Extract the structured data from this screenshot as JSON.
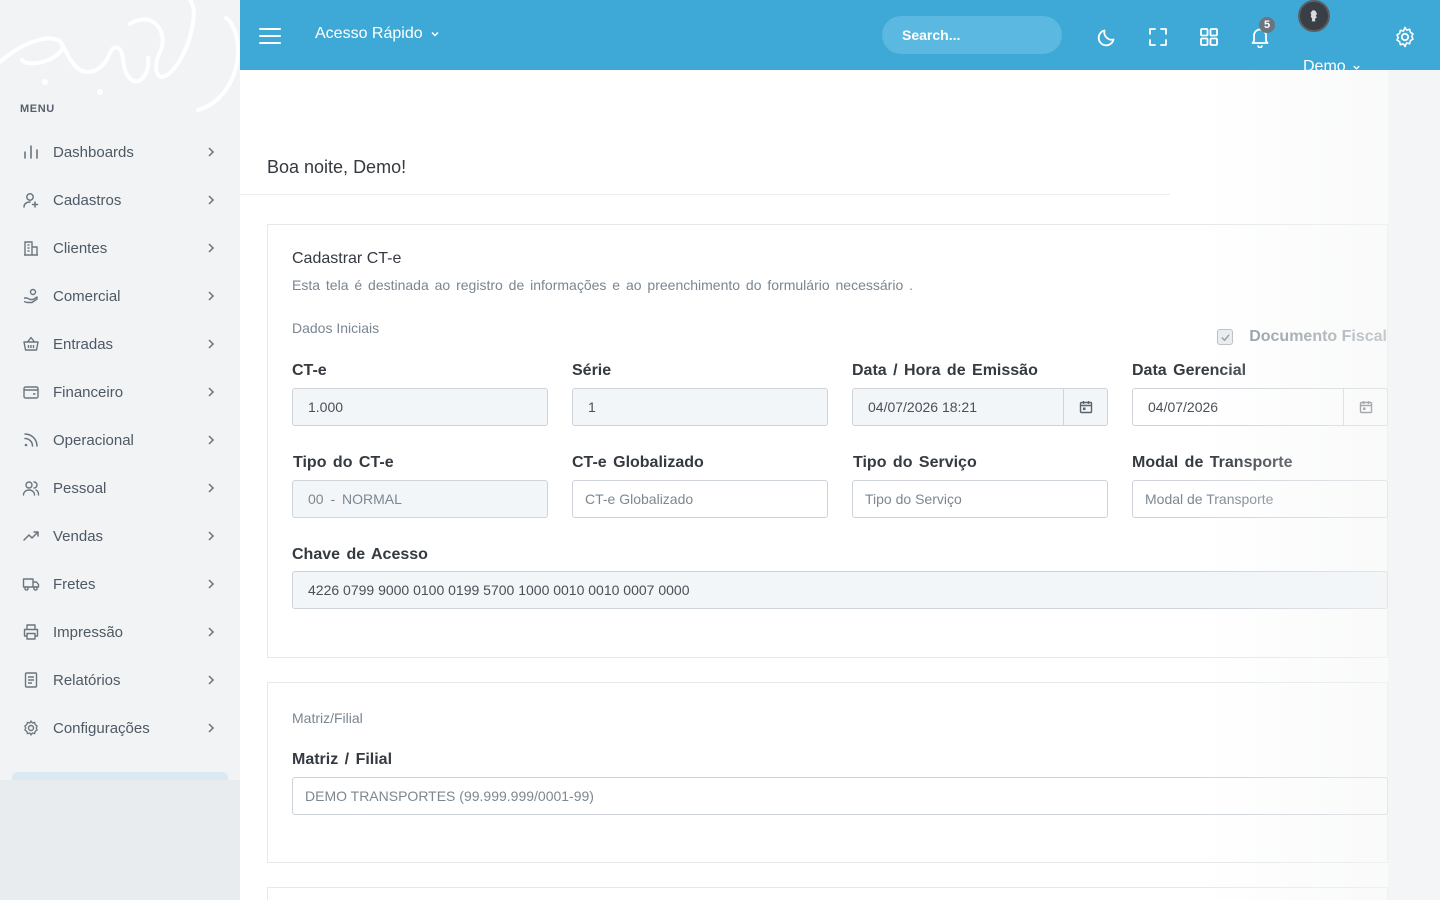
{
  "sidebar": {
    "menu_title": "MENU",
    "items": [
      {
        "label": "Dashboards",
        "icon": "bar-chart-icon"
      },
      {
        "label": "Cadastros",
        "icon": "user-plus-icon"
      },
      {
        "label": "Clientes",
        "icon": "building-icon"
      },
      {
        "label": "Comercial",
        "icon": "hand-coins-icon"
      },
      {
        "label": "Entradas",
        "icon": "basket-icon"
      },
      {
        "label": "Financeiro",
        "icon": "wallet-icon"
      },
      {
        "label": "Operacional",
        "icon": "rss-icon"
      },
      {
        "label": "Pessoal",
        "icon": "users-icon"
      },
      {
        "label": "Vendas",
        "icon": "trending-up-icon"
      },
      {
        "label": "Fretes",
        "icon": "truck-icon"
      },
      {
        "label": "Impressão",
        "icon": "printer-icon"
      },
      {
        "label": "Relatórios",
        "icon": "file-text-icon"
      },
      {
        "label": "Configurações",
        "icon": "settings-icon"
      }
    ]
  },
  "topbar": {
    "quick_access": "Acesso Rápido",
    "search_placeholder": "Search...",
    "notifications_count": "5",
    "user_name": "Demo"
  },
  "colors": {
    "topbar": "#3ea9d6",
    "sidebar": "#f2f3f4"
  },
  "main": {
    "greeting": "Boa noite, Demo!"
  },
  "form": {
    "title": "Cadastrar CT-e",
    "description": "Esta tela é destinada ao registro de informações e ao preenchimento do formulário necessário .",
    "section_initial": "Dados Iniciais",
    "documento_fiscal": "Documento Fiscal",
    "cte_label": "CT-e",
    "cte_value": "1.000",
    "serie_label": "Série",
    "serie_value": "1",
    "emissao_label": "Data / Hora de Emissão",
    "emissao_value": "04/07/2026 18:21",
    "gerencial_label": "Data Gerencial",
    "gerencial_value": "04/07/2026",
    "tipo_cte_label": "Tipo do CT-e",
    "tipo_cte_value": "00 - NORMAL",
    "globalizado_label": "CT-e Globalizado",
    "globalizado_placeholder": "CT-e Globalizado",
    "tipo_servico_label": "Tipo do Serviço",
    "tipo_servico_placeholder": "Tipo do Serviço",
    "modal_label": "Modal de Transporte",
    "modal_placeholder": "Modal de Transporte",
    "chave_label": "Chave de Acesso",
    "chave_value": "4226 0799 9000 0100 0199 5700 1000 0010 0010 0007 0000",
    "section_matriz": "Matriz/Filial",
    "matriz_label": "Matriz / Filial",
    "matriz_value": "DEMO TRANSPORTES (99.999.999/0001-99)"
  }
}
